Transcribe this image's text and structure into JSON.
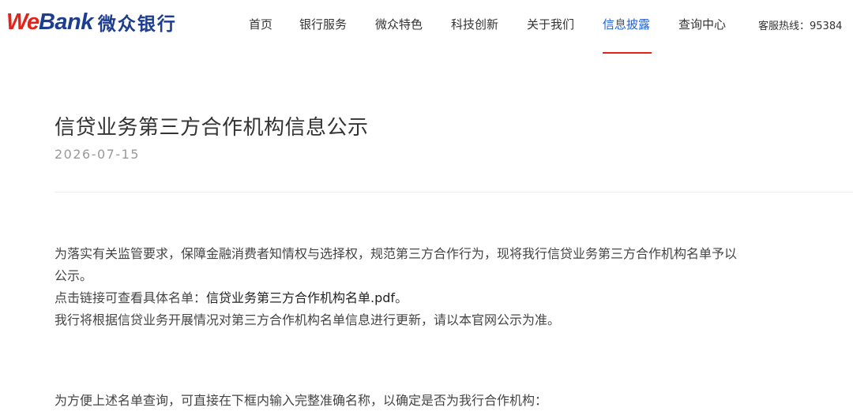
{
  "header": {
    "logo": {
      "we": "We",
      "bank": "Bank",
      "cn": "微众银行"
    },
    "nav": [
      {
        "label": "首页",
        "active": false
      },
      {
        "label": "银行服务",
        "active": false
      },
      {
        "label": "微众特色",
        "active": false
      },
      {
        "label": "科技创新",
        "active": false
      },
      {
        "label": "关于我们",
        "active": false
      },
      {
        "label": "信息披露",
        "active": true
      },
      {
        "label": "查询中心",
        "active": false
      }
    ],
    "hotline": "客服热线：95384"
  },
  "article": {
    "title": "信贷业务第三方合作机构信息公示",
    "date": "2026-07-15",
    "para1_line1": "为落实有关监管要求，保障金融消费者知情权与选择权，规范第三方合作行为，现将我行信贷业务第三方合作机构名单予以",
    "para1_line2": "公示。",
    "link_prefix": "点击链接可查看具体名单：",
    "link_text": "信贷业务第三方合作机构名单.pdf",
    "link_suffix": "。",
    "para3": "我行将根据信贷业务开展情况对第三方合作机构名单信息进行更新，请以本官网公示为准。",
    "para4": "为方便上述名单查询，可直接在下框内输入完整准确名称，以确定是否为我行合作机构："
  },
  "colors": {
    "brand_red": "#e2231a",
    "brand_blue": "#1d3d8f",
    "active_nav": "#1f5fd6"
  }
}
